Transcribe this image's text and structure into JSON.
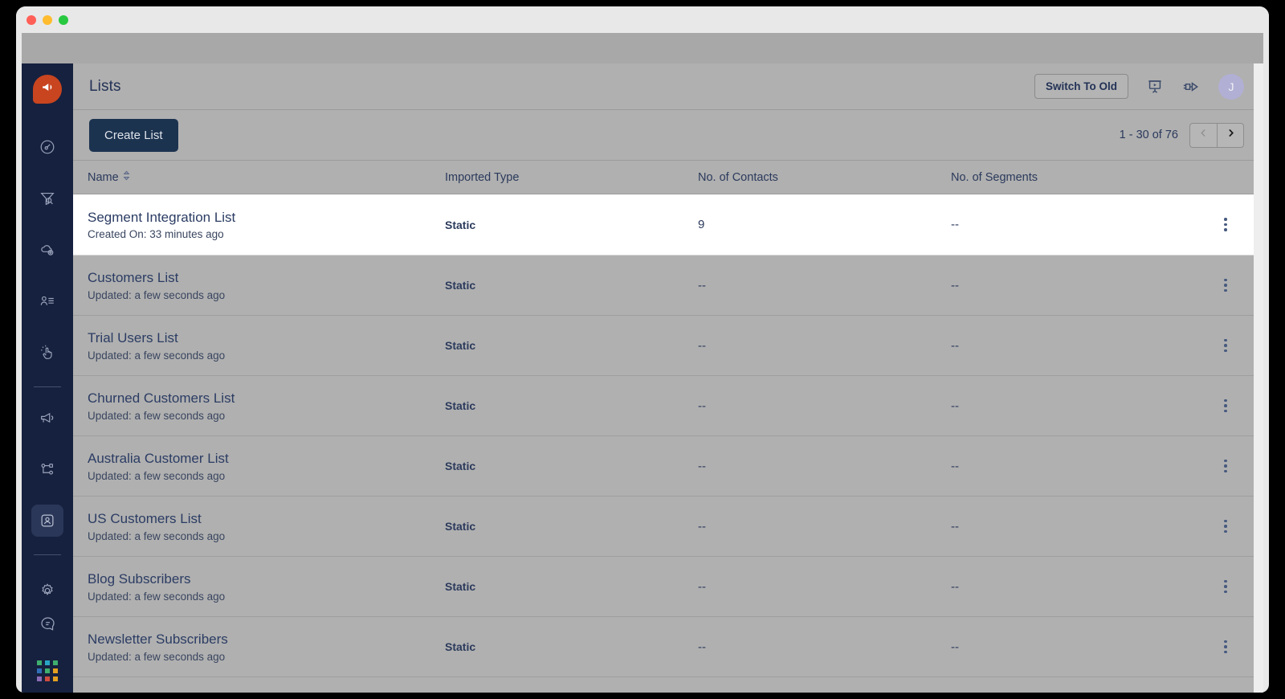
{
  "window": {
    "traffic_lights": [
      "close",
      "minimize",
      "zoom"
    ]
  },
  "sidebar": {
    "brand_icon": "megaphone-brand-icon",
    "items": [
      {
        "icon": "speedometer-icon",
        "name": "dashboard",
        "active": false
      },
      {
        "icon": "funnel-search-icon",
        "name": "funnels",
        "active": false
      },
      {
        "icon": "cloud-gear-icon",
        "name": "integrations",
        "active": false
      },
      {
        "icon": "person-lines-icon",
        "name": "contacts-feed",
        "active": false
      },
      {
        "icon": "click-hand-icon",
        "name": "events",
        "active": false
      },
      {
        "icon": "bullhorn-icon",
        "name": "campaigns",
        "active": false
      },
      {
        "icon": "workflow-nodes-icon",
        "name": "journeys",
        "active": false
      },
      {
        "icon": "person-card-icon",
        "name": "audience",
        "active": true
      },
      {
        "icon": "gear-icon",
        "name": "settings",
        "active": false
      },
      {
        "icon": "chat-bubble-icon",
        "name": "support-chat",
        "active": false
      }
    ],
    "app_grid": {
      "icon": "app-grid-icon",
      "colors": [
        "#3fae6e",
        "#2aa4c4",
        "#3fae6e",
        "#2f6fb5",
        "#3fae6e",
        "#e2a020",
        "#8a6bb5",
        "#cf4b3f",
        "#e2a020"
      ]
    }
  },
  "header": {
    "title": "Lists",
    "switch_button": "Switch To Old",
    "presentation_icon": "presentation-screen-icon",
    "plug_icon": "plug-icon",
    "avatar_initial": "J"
  },
  "actionbar": {
    "create_button": "Create List",
    "pagination_label": "1 - 30 of 76",
    "prev_icon": "chevron-left-icon",
    "next_icon": "chevron-right-icon"
  },
  "table": {
    "columns": [
      {
        "label": "Name",
        "sortable": true,
        "sort_icon": "sort-arrows-icon"
      },
      {
        "label": "Imported Type",
        "sortable": false
      },
      {
        "label": "No. of Contacts",
        "sortable": false
      },
      {
        "label": "No. of Segments",
        "sortable": false
      }
    ],
    "rows": [
      {
        "name": "Segment Integration List",
        "meta": "Created On: 33 minutes ago",
        "imported_type": "Static",
        "contacts": "9",
        "segments": "--",
        "highlighted": true
      },
      {
        "name": "Customers List",
        "meta": "Updated: a few seconds ago",
        "imported_type": "Static",
        "contacts": "--",
        "segments": "--",
        "highlighted": false
      },
      {
        "name": "Trial Users List",
        "meta": "Updated: a few seconds ago",
        "imported_type": "Static",
        "contacts": "--",
        "segments": "--",
        "highlighted": false
      },
      {
        "name": "Churned Customers List",
        "meta": "Updated: a few seconds ago",
        "imported_type": "Static",
        "contacts": "--",
        "segments": "--",
        "highlighted": false
      },
      {
        "name": "Australia Customer List",
        "meta": "Updated: a few seconds ago",
        "imported_type": "Static",
        "contacts": "--",
        "segments": "--",
        "highlighted": false
      },
      {
        "name": "US Customers List",
        "meta": "Updated: a few seconds ago",
        "imported_type": "Static",
        "contacts": "--",
        "segments": "--",
        "highlighted": false
      },
      {
        "name": "Blog Subscribers",
        "meta": "Updated: a few seconds ago",
        "imported_type": "Static",
        "contacts": "--",
        "segments": "--",
        "highlighted": false
      },
      {
        "name": "Newsletter Subscribers",
        "meta": "Updated: a few seconds ago",
        "imported_type": "Static",
        "contacts": "--",
        "segments": "--",
        "highlighted": false
      }
    ],
    "row_menu_icon": "kebab-menu-icon"
  },
  "colors": {
    "sidebar_bg": "#16213f",
    "brand": "#c8451f",
    "primary_button": "#1c3350",
    "text_primary": "#2b3a5c",
    "avatar_bg": "#b1afd4",
    "overlay_gray": "#b0b0b0"
  }
}
